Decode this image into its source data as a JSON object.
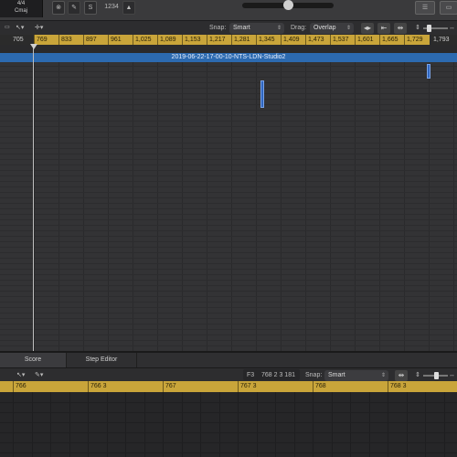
{
  "lcd": {
    "signature": "4/4",
    "key": "Cmaj"
  },
  "top_buttons": [
    "",
    "",
    "S",
    "1234",
    ""
  ],
  "toolbar": {
    "snap_label": "Snap:",
    "snap_value": "Smart",
    "drag_label": "Drag:",
    "drag_value": "Overlap"
  },
  "ruler": {
    "start": "705",
    "bars": [
      "769",
      "833",
      "897",
      "961",
      "1,025",
      "1,089",
      "1,153",
      "1,217",
      "1,281",
      "1,345",
      "1,409",
      "1,473",
      "1,537",
      "1,601",
      "1,665",
      "1,729"
    ],
    "end": "1,793"
  },
  "region": {
    "title": "2019-06-22-17-00-10-NTS-LDN-Studio2"
  },
  "editor": {
    "tab_score": "Score",
    "tab_step": "Step Editor",
    "position_note": "F3",
    "position_value": "768 2 3 181",
    "snap_label": "Snap:",
    "snap_value": "Smart",
    "ruler": [
      "766",
      "766 3",
      "767",
      "767 3",
      "768",
      "768 3"
    ]
  }
}
